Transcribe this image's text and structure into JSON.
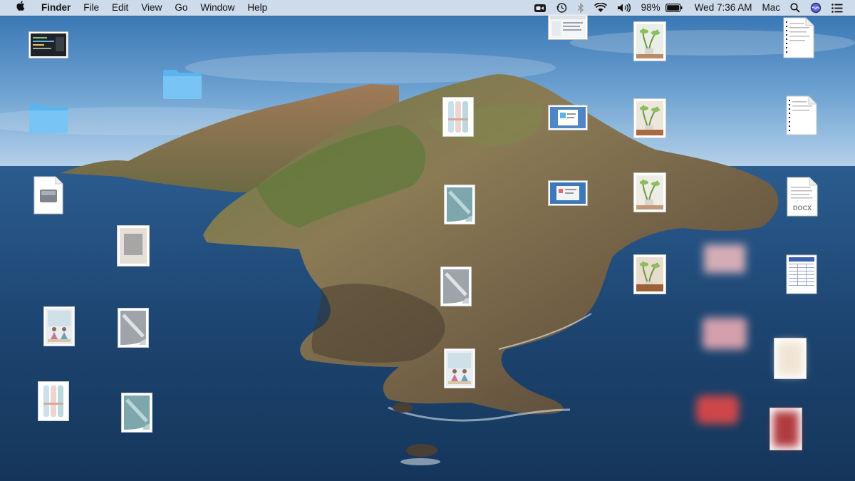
{
  "menubar": {
    "apple": "apple-logo",
    "app_name": "Finder",
    "menus": [
      "File",
      "Edit",
      "View",
      "Go",
      "Window",
      "Help"
    ],
    "status": {
      "battery_percent": "98%",
      "datetime": "Wed 7:36 AM",
      "user": "Mac",
      "battery_level": 0.98,
      "icons": [
        "facetime-icon",
        "time-machine-icon",
        "bluetooth-icon",
        "wifi-icon",
        "volume-icon",
        "battery-icon",
        "spotlight-icon",
        "siri-icon",
        "notification-center-icon"
      ]
    }
  },
  "desktop": {
    "wallpaper": "macOS Catalina island",
    "icons": [
      {
        "kind": "screenshot-dark",
        "label": ""
      },
      {
        "kind": "folder",
        "label": ""
      },
      {
        "kind": "folder",
        "label": ""
      },
      {
        "kind": "disk-image-doc",
        "label": ""
      },
      {
        "kind": "photo-gray",
        "label": ""
      },
      {
        "kind": "yoga-photo",
        "label": ""
      },
      {
        "kind": "silver-sheet",
        "label": ""
      },
      {
        "kind": "towels-photo",
        "label": ""
      },
      {
        "kind": "teal-sheet",
        "label": ""
      },
      {
        "kind": "towels-photo",
        "label": ""
      },
      {
        "kind": "teal-sheet",
        "label": ""
      },
      {
        "kind": "silver-sheet",
        "label": ""
      },
      {
        "kind": "yoga-photo",
        "label": ""
      },
      {
        "kind": "screenshot-window",
        "label": ""
      },
      {
        "kind": "screenshot-window",
        "label": ""
      },
      {
        "kind": "screenshot-window",
        "label": ""
      },
      {
        "kind": "plant-photo",
        "label": ""
      },
      {
        "kind": "plant-photo",
        "label": ""
      },
      {
        "kind": "plant-photo",
        "label": ""
      },
      {
        "kind": "plant-photo",
        "label": ""
      },
      {
        "kind": "text-document",
        "label": ""
      },
      {
        "kind": "text-document",
        "label": ""
      },
      {
        "kind": "docx-document",
        "label": "DOCX"
      },
      {
        "kind": "spreadsheet-document",
        "label": ""
      },
      {
        "kind": "pink-image",
        "label": ""
      },
      {
        "kind": "pink-image",
        "label": ""
      },
      {
        "kind": "red-image",
        "label": ""
      },
      {
        "kind": "beige-image",
        "label": ""
      },
      {
        "kind": "red-rug-image",
        "label": ""
      }
    ]
  },
  "colors": {
    "menubar_bg": "#e8ecf4",
    "sky_top": "#2f6fae",
    "sky_bottom": "#a9c9e4",
    "sea": "#1c3f66",
    "folder_blue": "#5ab4ee"
  }
}
